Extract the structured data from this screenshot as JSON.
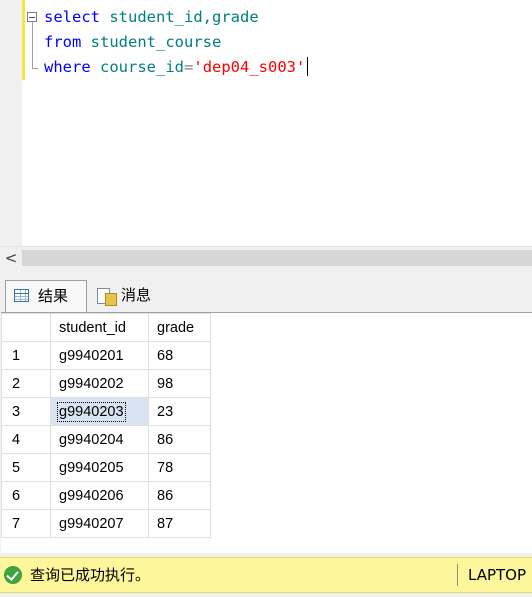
{
  "editor": {
    "lines": [
      {
        "keyword": "select",
        "text": "student_id,grade"
      },
      {
        "keyword": "from",
        "text": "student_course"
      },
      {
        "keyword": "where",
        "column": "course_id",
        "operator": "=",
        "value": "'dep04_s003'"
      }
    ]
  },
  "scrollbar": {
    "left_arrow": "<"
  },
  "results": {
    "tabs": [
      {
        "label": "结果",
        "icon": "grid-icon"
      },
      {
        "label": "消息",
        "icon": "message-icon"
      }
    ],
    "columns": [
      "",
      "student_id",
      "grade"
    ],
    "rows": [
      {
        "num": "1",
        "student_id": "g9940201",
        "grade": "68"
      },
      {
        "num": "2",
        "student_id": "g9940202",
        "grade": "98"
      },
      {
        "num": "3",
        "student_id": "g9940203",
        "grade": "23"
      },
      {
        "num": "4",
        "student_id": "g9940204",
        "grade": "86"
      },
      {
        "num": "5",
        "student_id": "g9940205",
        "grade": "78"
      },
      {
        "num": "6",
        "student_id": "g9940206",
        "grade": "86"
      },
      {
        "num": "7",
        "student_id": "g9940207",
        "grade": "87"
      }
    ],
    "selected_cell": {
      "row": 3,
      "column": "student_id"
    }
  },
  "status": {
    "message": "查询已成功执行。",
    "server": "LAPTOP",
    "icon": "success-check-icon",
    "color": "#fdf69a"
  }
}
